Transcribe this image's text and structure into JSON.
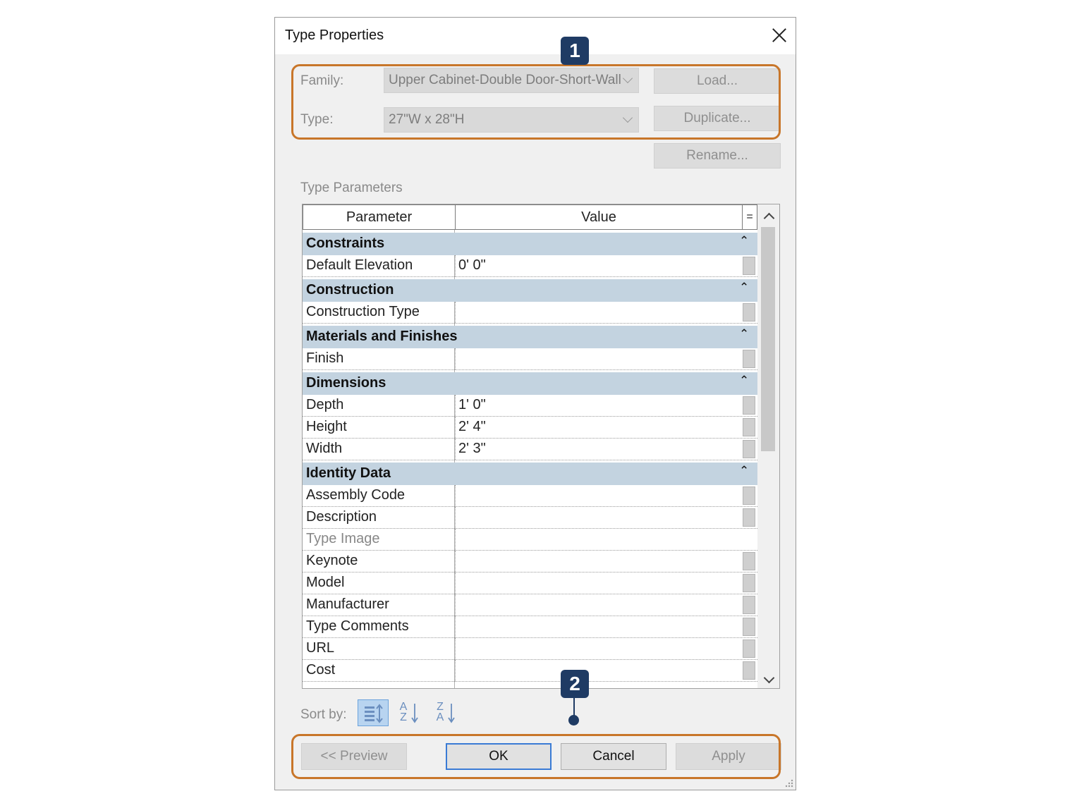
{
  "dialog": {
    "title": "Type Properties",
    "family_label": "Family:",
    "family_value": "Upper Cabinet-Double Door-Short-Wall",
    "type_label": "Type:",
    "type_value": "27\"W x 28\"H",
    "load_label": "Load...",
    "duplicate_label": "Duplicate...",
    "rename_label": "Rename...",
    "section_label": "Type Parameters"
  },
  "grid": {
    "columns": {
      "parameter": "Parameter",
      "value": "Value",
      "toggle": "="
    },
    "groups": [
      {
        "name": "Constraints",
        "rows": [
          {
            "name": "Default Elevation",
            "value": "0'  0\""
          }
        ]
      },
      {
        "name": "Construction",
        "rows": [
          {
            "name": "Construction Type",
            "value": ""
          }
        ]
      },
      {
        "name": "Materials and Finishes",
        "rows": [
          {
            "name": "Finish",
            "value": ""
          }
        ]
      },
      {
        "name": "Dimensions",
        "rows": [
          {
            "name": "Depth",
            "value": "1'  0\""
          },
          {
            "name": "Height",
            "value": "2'  4\""
          },
          {
            "name": "Width",
            "value": "2'  3\""
          }
        ]
      },
      {
        "name": "Identity Data",
        "rows": [
          {
            "name": "Assembly Code",
            "value": ""
          },
          {
            "name": "Description",
            "value": ""
          },
          {
            "name": "Type Image",
            "value": ""
          },
          {
            "name": "Keynote",
            "value": ""
          },
          {
            "name": "Model",
            "value": ""
          },
          {
            "name": "Manufacturer",
            "value": ""
          },
          {
            "name": "Type Comments",
            "value": ""
          },
          {
            "name": "URL",
            "value": ""
          },
          {
            "name": "Cost",
            "value": ""
          }
        ]
      }
    ],
    "collapse_glyph": "⌃"
  },
  "sort": {
    "label": "Sort by:",
    "az_top": "A",
    "az_bottom": "Z",
    "za_top": "Z",
    "za_bottom": "A"
  },
  "footer": {
    "preview_label": "<< Preview",
    "ok_label": "OK",
    "cancel_label": "Cancel",
    "apply_label": "Apply"
  },
  "callouts": {
    "one": "1",
    "two": "2"
  },
  "colors": {
    "group_header": "#c3d3e0",
    "callout_border": "#c8762a",
    "badge": "#1f3b64"
  }
}
